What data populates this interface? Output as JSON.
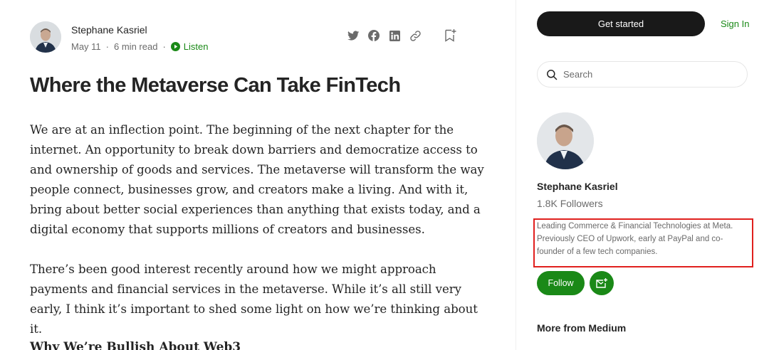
{
  "article": {
    "author_name": "Stephane Kasriel",
    "date": "May 11",
    "separator": "·",
    "read_time": "6 min read",
    "listen_label": "Listen",
    "title": "Where the Metaverse Can Take FinTech",
    "paragraphs": [
      "We are at an inflection point. The beginning of the next chapter for the internet. An opportunity to break down barriers and democratize access to and ownership of goods and services. The metaverse will transform the way people connect, businesses grow, and creators make a living. And with it, bring about better social experiences than anything that exists today, and a digital economy that supports millions of creators and businesses.",
      "There’s been good interest recently around how we might approach payments and financial services in the metaverse. While it’s all still very early, I think it’s important to shed some light on how we’re thinking about it."
    ],
    "subheading": "Why We’re Bullish About Web3",
    "share_icons": [
      "twitter-icon",
      "facebook-icon",
      "linkedin-icon",
      "link-icon",
      "bookmark-icon"
    ]
  },
  "sidebar": {
    "get_started_label": "Get started",
    "sign_in_label": "Sign In",
    "search": {
      "placeholder": "Search",
      "value": ""
    },
    "author_name": "Stephane Kasriel",
    "followers": "1.8K Followers",
    "bio": "Leading Commerce & Financial Technologies at Meta. Previously CEO of Upwork, early at PayPal and co-founder of a few tech companies.",
    "follow_label": "Follow",
    "more_from_label": "More from Medium"
  },
  "colors": {
    "accent_green": "#1a8917",
    "text_primary": "#242424",
    "text_secondary": "#6b6b6b",
    "dark_button": "#191919",
    "highlight_red": "#e0201e"
  }
}
